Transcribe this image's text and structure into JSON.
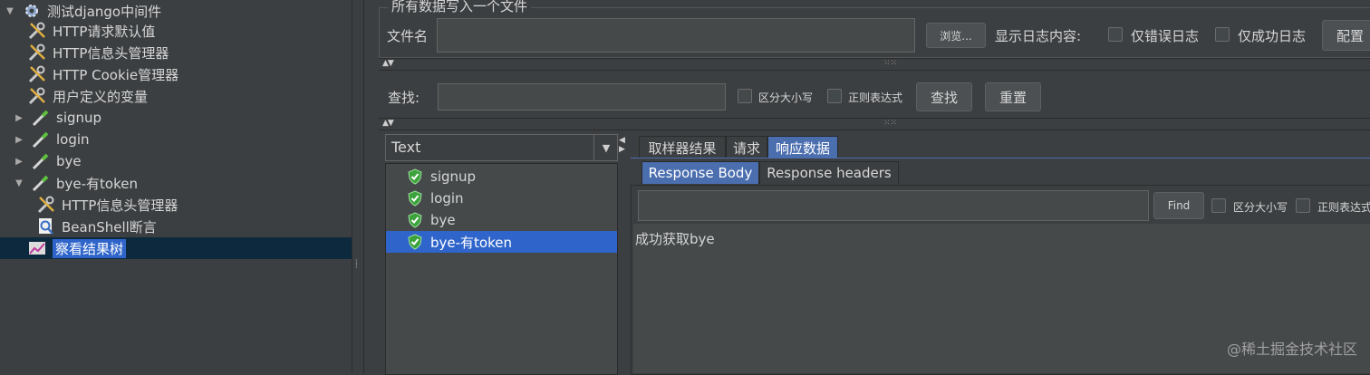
{
  "tree": {
    "root": {
      "label": "测试django中间件",
      "icon": "gear-icon"
    },
    "items": [
      {
        "label": "HTTP请求默认值",
        "icon": "wrench-icon"
      },
      {
        "label": "HTTP信息头管理器",
        "icon": "wrench-icon"
      },
      {
        "label": "HTTP Cookie管理器",
        "icon": "wrench-icon"
      },
      {
        "label": "用户定义的变量",
        "icon": "wrench-icon"
      },
      {
        "label": "signup",
        "icon": "pipette-icon"
      },
      {
        "label": "login",
        "icon": "pipette-icon"
      },
      {
        "label": "bye",
        "icon": "pipette-icon"
      },
      {
        "label": "bye-有token",
        "icon": "pipette-icon"
      },
      {
        "label": "HTTP信息头管理器",
        "icon": "wrench-icon"
      },
      {
        "label": "BeanShell断言",
        "icon": "magnifier-icon"
      },
      {
        "label": "察看结果树",
        "icon": "graph-icon"
      }
    ]
  },
  "file_section": {
    "legend": "所有数据写入一个文件",
    "filename_label": "文件名",
    "browse_label": "浏览...",
    "log_label": "显示日志内容:",
    "errors_only_label": "仅错误日志",
    "success_only_label": "仅成功日志",
    "config_label": "配置"
  },
  "search": {
    "label": "查找:",
    "case_label": "区分大小写",
    "regex_label": "正则表达式",
    "find_label": "查找",
    "reset_label": "重置"
  },
  "renderer": {
    "selected": "Text"
  },
  "results": [
    {
      "label": "signup",
      "status": "success"
    },
    {
      "label": "login",
      "status": "success"
    },
    {
      "label": "bye",
      "status": "success"
    },
    {
      "label": "bye-有token",
      "status": "success"
    }
  ],
  "tabs": [
    "取样器结果",
    "请求",
    "响应数据"
  ],
  "subtabs": [
    "Response Body",
    "Response headers"
  ],
  "response": {
    "find_label": "Find",
    "case_label": "区分大小写",
    "regex_label": "正则表达式",
    "body": "成功获取bye"
  },
  "watermark": "@稀土掘金技术社区",
  "colors": {
    "accent": "#2f65ca",
    "tab_active": "#4b6eaf",
    "success": "#3ca23c"
  }
}
